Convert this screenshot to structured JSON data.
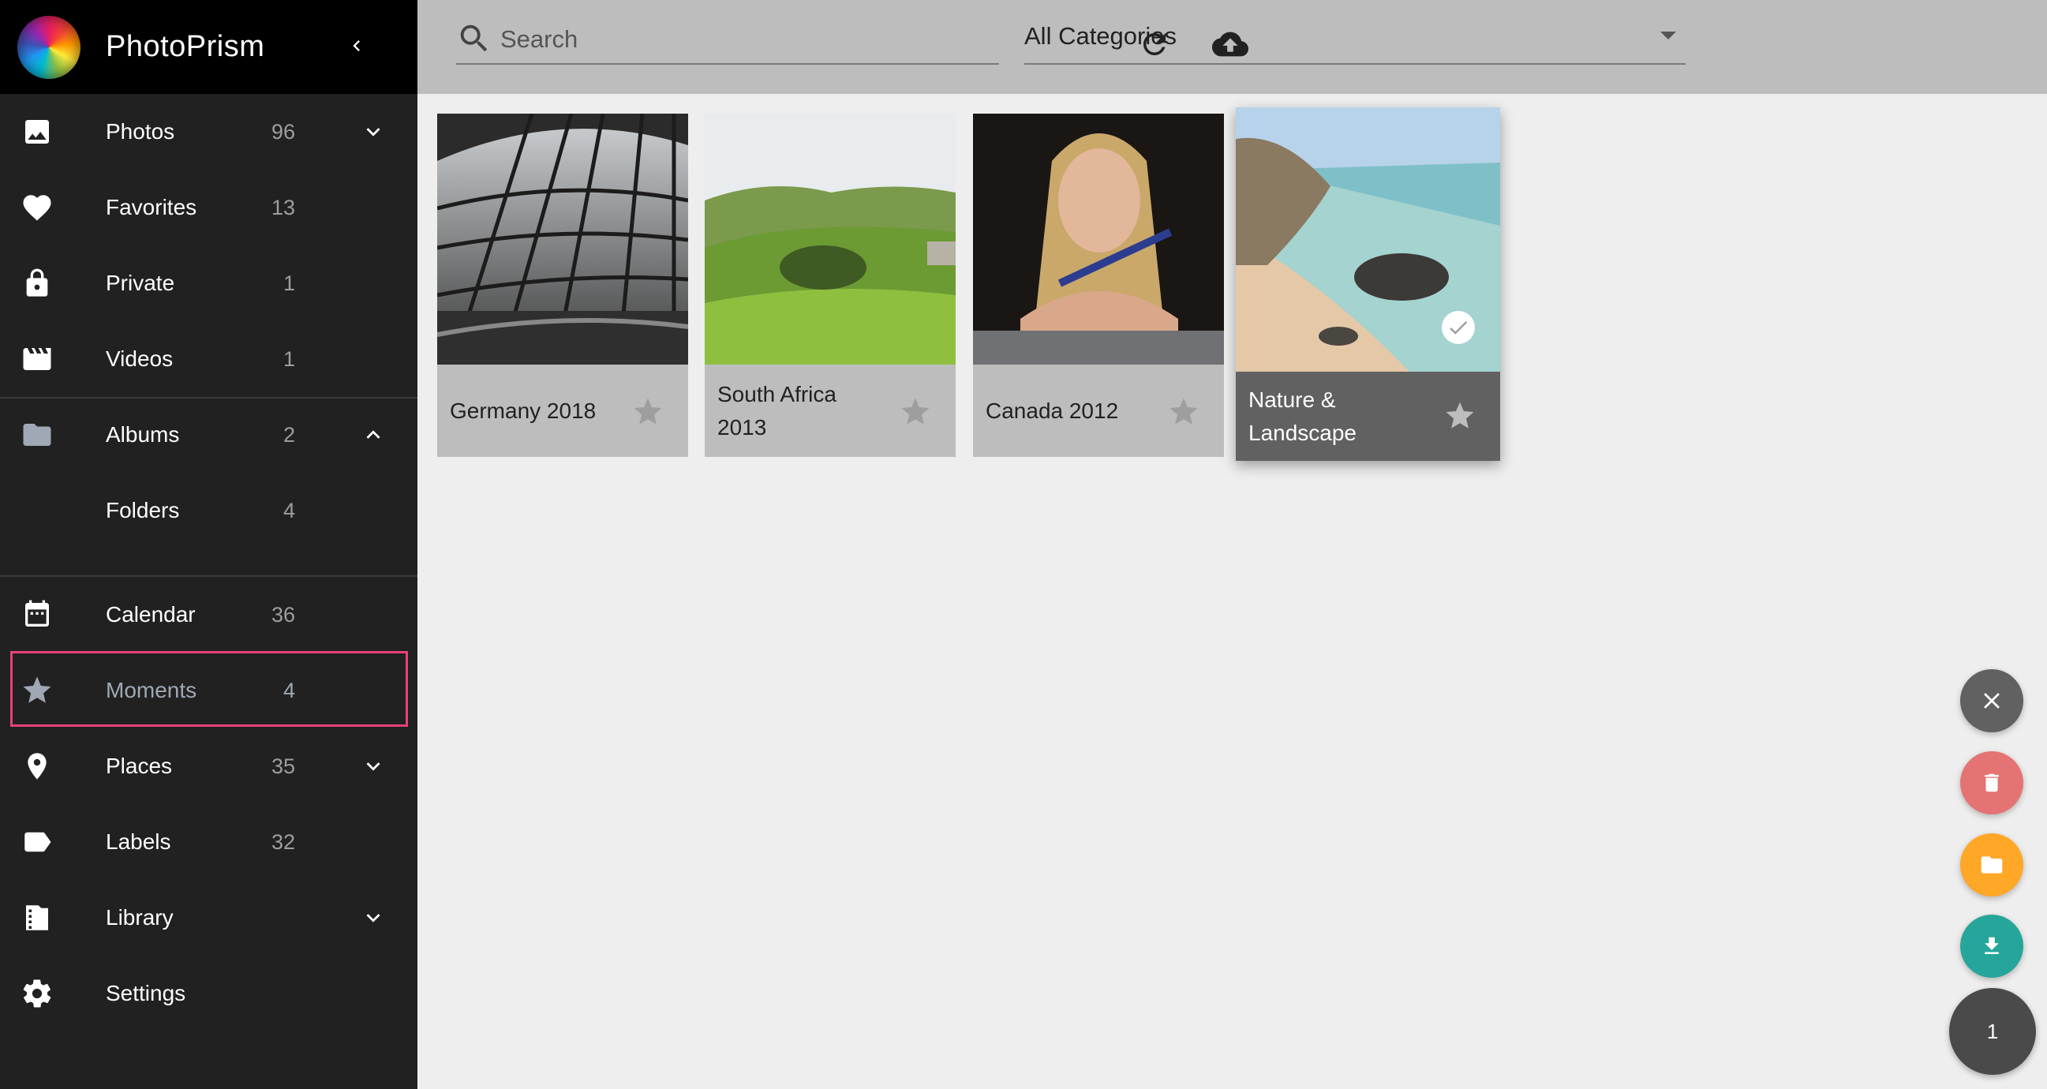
{
  "app": {
    "name": "PhotoPrism"
  },
  "sidebar": {
    "items": [
      {
        "label": "Photos",
        "count": "96",
        "icon": "image-icon",
        "expand": "down"
      },
      {
        "label": "Favorites",
        "count": "13",
        "icon": "heart-icon"
      },
      {
        "label": "Private",
        "count": "1",
        "icon": "lock-icon"
      },
      {
        "label": "Videos",
        "count": "1",
        "icon": "movie-icon"
      },
      {
        "label": "Albums",
        "count": "2",
        "icon": "folder-icon",
        "expand": "up"
      },
      {
        "label": "Folders",
        "count": "4",
        "icon": ""
      },
      {
        "label": "Calendar",
        "count": "36",
        "icon": "calendar-icon"
      },
      {
        "label": "Moments",
        "count": "4",
        "icon": "star-icon",
        "active": true
      },
      {
        "label": "Places",
        "count": "35",
        "icon": "place-icon",
        "expand": "down"
      },
      {
        "label": "Labels",
        "count": "32",
        "icon": "label-icon"
      },
      {
        "label": "Library",
        "count": "",
        "icon": "library-icon",
        "expand": "down"
      },
      {
        "label": "Settings",
        "count": "",
        "icon": "gear-icon"
      }
    ]
  },
  "toolbar": {
    "search_placeholder": "Search",
    "category": "All Categories"
  },
  "cards": [
    {
      "title": "Germany 2018",
      "selected": false
    },
    {
      "title": "South Africa 2013",
      "selected": false
    },
    {
      "title": "Canada 2012",
      "selected": false
    },
    {
      "title": "Nature & Landscape",
      "selected": true
    }
  ],
  "fab": {
    "selected_count": "1"
  },
  "colors": {
    "sidebar_bg": "#212121",
    "topbar_bg": "#bdbdbd",
    "highlight": "#e8417a",
    "fab_close": "#616161",
    "fab_delete": "#e57373",
    "fab_album": "#ffa726",
    "fab_download": "#26a69a"
  }
}
